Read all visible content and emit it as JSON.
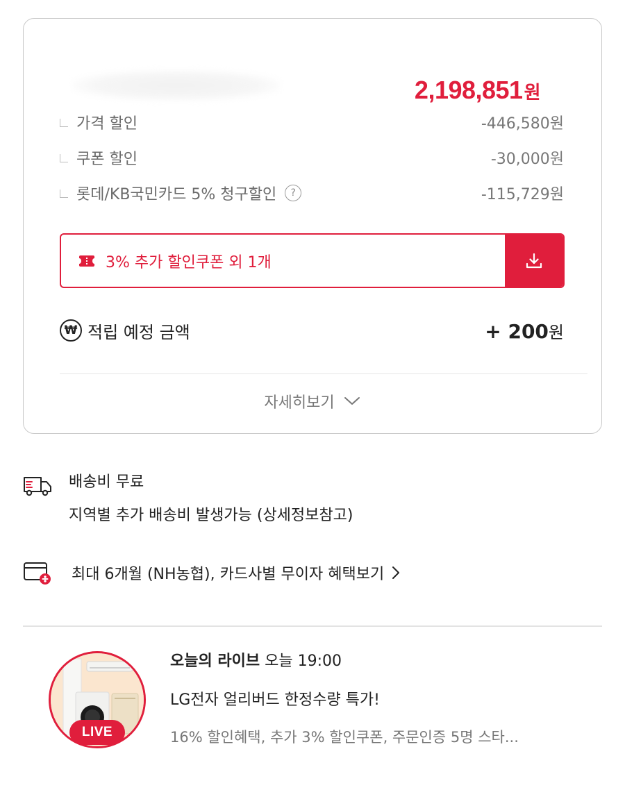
{
  "price_card": {
    "total_price": "2,198,851",
    "total_unit": "원",
    "discounts": [
      {
        "label": "가격 할인",
        "value": "-446,580원"
      },
      {
        "label": "쿠폰 할인",
        "value": "-30,000원"
      },
      {
        "label": "롯데/KB국민카드 5% 청구할인",
        "value": "-115,729원",
        "help": "?"
      }
    ],
    "coupon_button_label": "3% 추가 할인쿠폰 외 1개",
    "reward": {
      "icon_glyph": "₩",
      "label": "적립 예정 금액",
      "value": "+ 200",
      "unit": "원"
    },
    "detail_link": "자세히보기"
  },
  "shipping": {
    "title": "배송비 무료",
    "description": "지역별 추가 배송비 발생가능 (상세정보참고)"
  },
  "installment": {
    "text": "최대 6개월 (NH농협), 카드사별 무이자 혜택보기"
  },
  "live": {
    "label": "오늘의 라이브",
    "time": "오늘 19:00",
    "title": "LG전자 얼리버드 한정수량 특가!",
    "description": "16% 할인혜택, 추가 3% 할인쿠폰, 주문인증 5명 스타...",
    "badge": "LIVE"
  },
  "colors": {
    "accent": "#e01e3c",
    "muted_text": "#777777",
    "border": "#c9c9c9"
  },
  "icons": [
    "ticket-icon",
    "download-icon",
    "won-circle-icon",
    "question-circle-icon",
    "chevron-down-icon",
    "delivery-truck-icon",
    "card-installment-icon",
    "chevron-right-icon"
  ]
}
